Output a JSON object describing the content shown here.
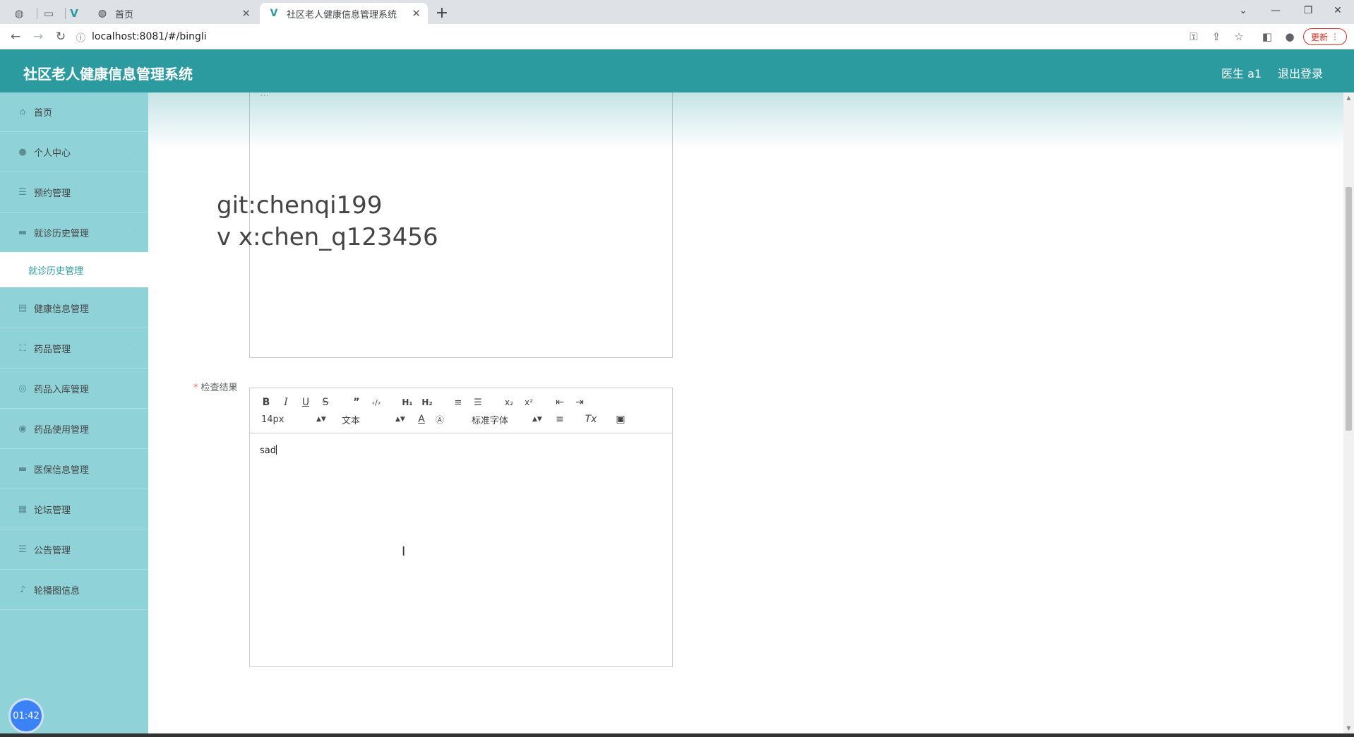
{
  "browser": {
    "tabs": [
      {
        "label": "首页",
        "active": false
      },
      {
        "label": "社区老人健康信息管理系统",
        "active": true
      }
    ],
    "url": "localhost:8081/#/bingli",
    "update_label": "更新"
  },
  "header": {
    "title": "社区老人健康信息管理系统",
    "user": "医生 a1",
    "logout": "退出登录"
  },
  "sidebar": {
    "items": [
      {
        "label": "首页"
      },
      {
        "label": "个人中心"
      },
      {
        "label": "预约管理"
      },
      {
        "label": "就诊历史管理"
      },
      {
        "label": "健康信息管理"
      },
      {
        "label": "药品管理"
      },
      {
        "label": "药品入库管理"
      },
      {
        "label": "药品使用管理"
      },
      {
        "label": "医保信息管理"
      },
      {
        "label": "论坛管理"
      },
      {
        "label": "公告管理"
      },
      {
        "label": "轮播图信息"
      }
    ],
    "submenu_active": "就诊历史管理",
    "timer": "01:42"
  },
  "watermark": {
    "line1": "git:chenqi199",
    "line2": "v x:chen_q123456"
  },
  "form": {
    "exam_result_label": "检查结果",
    "editor": {
      "size_picker": "14px",
      "header_picker": "文本",
      "font_picker": "标准字体",
      "content": "sad"
    }
  }
}
